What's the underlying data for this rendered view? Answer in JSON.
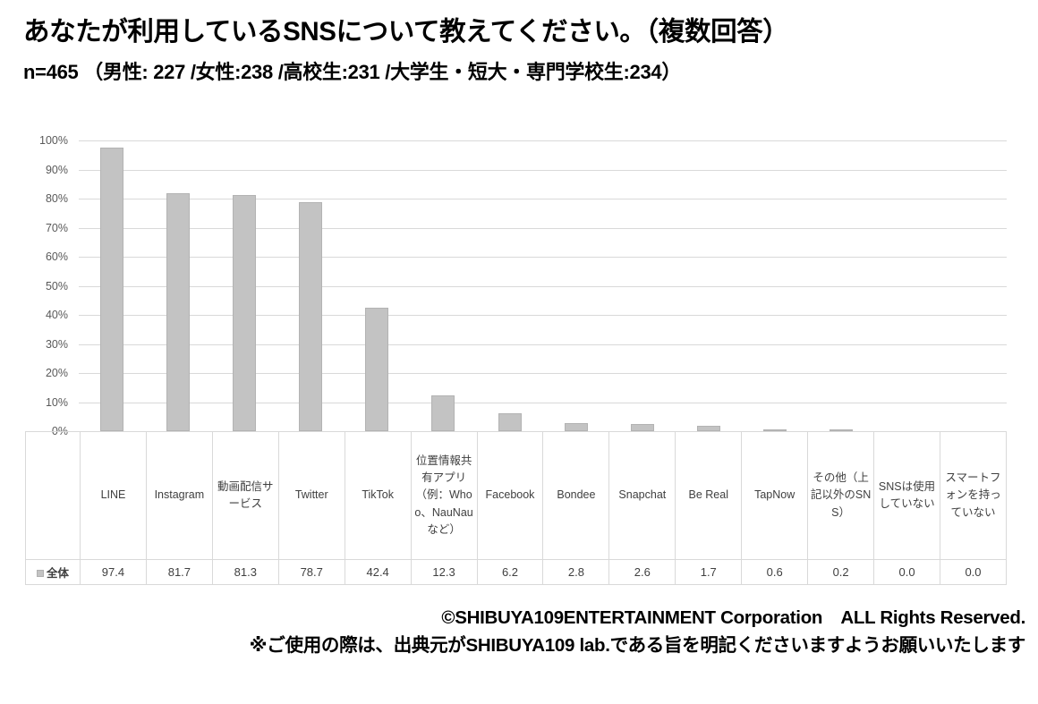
{
  "header": {
    "title": "あなたが利用しているSNSについて教えてください。（複数回答）",
    "subtitle": "n=465 （男性: 227 /女性:238 /高校生:231 /大学生・短大・専門学校生:234）"
  },
  "legend": {
    "series_label": "全体",
    "swatch_color": "#c3c3c3"
  },
  "footer": {
    "line1": "©SHIBUYA109ENTERTAINMENT Corporation　ALL Rights Reserved.",
    "line2": "※ご使用の際は、出典元がSHIBUYA109 lab.である旨を明記くださいますようお願いいたします"
  },
  "chart_data": {
    "type": "bar",
    "title": "あなたが利用しているSNSについて教えてください。（複数回答）",
    "subtitle": "n=465 （男性: 227 /女性:238 /高校生:231 /大学生・短大・専門学校生:234）",
    "xlabel": "",
    "ylabel": "",
    "ylim": [
      0,
      100
    ],
    "yticks": [
      "0%",
      "10%",
      "20%",
      "30%",
      "40%",
      "50%",
      "60%",
      "70%",
      "80%",
      "90%",
      "100%"
    ],
    "ytick_values": [
      0,
      10,
      20,
      30,
      40,
      50,
      60,
      70,
      80,
      90,
      100
    ],
    "grid": true,
    "legend_position": "data-table-row",
    "bar_color": "#c3c3c3",
    "categories": [
      "LINE",
      "Instagram",
      "動画配信サービス",
      "Twitter",
      "TikTok",
      "位置情報共有アプリ（例：Whoo、NauNauなど）",
      "Facebook",
      "Bondee",
      "Snapchat",
      "Be Real",
      "TapNow",
      "その他（上記以外のSNS）",
      "SNSは使用していない",
      "スマートフォンを持っていない"
    ],
    "series": [
      {
        "name": "全体",
        "values": [
          97.4,
          81.7,
          81.3,
          78.7,
          42.4,
          12.3,
          6.2,
          2.8,
          2.6,
          1.7,
          0.6,
          0.2,
          0.0,
          0.0
        ]
      }
    ],
    "value_labels": [
      "97.4",
      "81.7",
      "81.3",
      "78.7",
      "42.4",
      "12.3",
      "6.2",
      "2.8",
      "2.6",
      "1.7",
      "0.6",
      "0.2",
      "0.0",
      "0.0"
    ]
  }
}
